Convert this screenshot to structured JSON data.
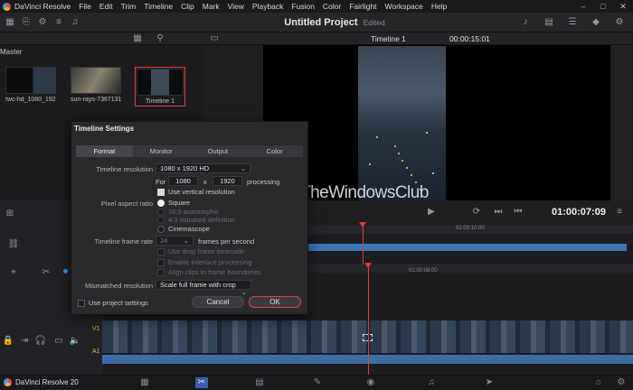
{
  "menubar": {
    "app_name": "DaVinci Resolve",
    "items": [
      "File",
      "Edit",
      "Trim",
      "Timeline",
      "Clip",
      "Mark",
      "View",
      "Playback",
      "Fusion",
      "Color",
      "Fairlight",
      "Workspace",
      "Help"
    ]
  },
  "project": {
    "title": "Untitled Project",
    "status": "Edited"
  },
  "viewer": {
    "timeline_name": "Timeline 1",
    "timecode_top": "00:00:15:01",
    "timecode_main": "01:00:07:09"
  },
  "media_pool": {
    "bin_label": "Master",
    "clips": [
      {
        "name": "twc-hd_1080_192..."
      },
      {
        "name": "sun-rays-7367131..."
      },
      {
        "name": "Timeline 1"
      }
    ]
  },
  "timeline": {
    "ruler_label_1": "01:00:10:00",
    "ruler_label_2": "01:00:08:00",
    "track_v1": "V1",
    "track_a1": "A1"
  },
  "watermark": {
    "text": "TheWindowsClub"
  },
  "dialog": {
    "title": "Timeline Settings",
    "tabs": [
      "Format",
      "Monitor",
      "Output",
      "Color"
    ],
    "active_tab": "Format",
    "timeline_resolution_label": "Timeline resolution",
    "timeline_resolution_value": "1080 x 1920 HD",
    "for_label": "For",
    "width": "1080",
    "x_label": "x",
    "height": "1920",
    "processing_label": "processing",
    "use_vertical_label": "Use vertical resolution",
    "pixel_aspect_label": "Pixel aspect ratio",
    "par_square": "Square",
    "par_anamorphic": "16:9 anamorphic",
    "par_standard": "4:3 standard definition",
    "par_cinemascope": "Cinemascope",
    "frame_rate_label": "Timeline frame rate",
    "frame_rate_value": "24",
    "fps_label": "frames per second",
    "drop_frame_label": "Use drop frame timecode",
    "interlace_label": "Enable interlace processing",
    "align_clips_label": "Align clips to frame boundaries",
    "mismatched_label": "Mismatched resolution",
    "mismatched_value": "Scale full frame with crop",
    "use_project_label": "Use project settings",
    "cancel_label": "Cancel",
    "ok_label": "OK"
  },
  "bottom_bar": {
    "brand": "DaVinci Resolve 20"
  },
  "colors": {
    "accent_red": "#e23b3b",
    "track_blue": "#3b78b8",
    "dialog_bg": "#2a2a2d"
  }
}
